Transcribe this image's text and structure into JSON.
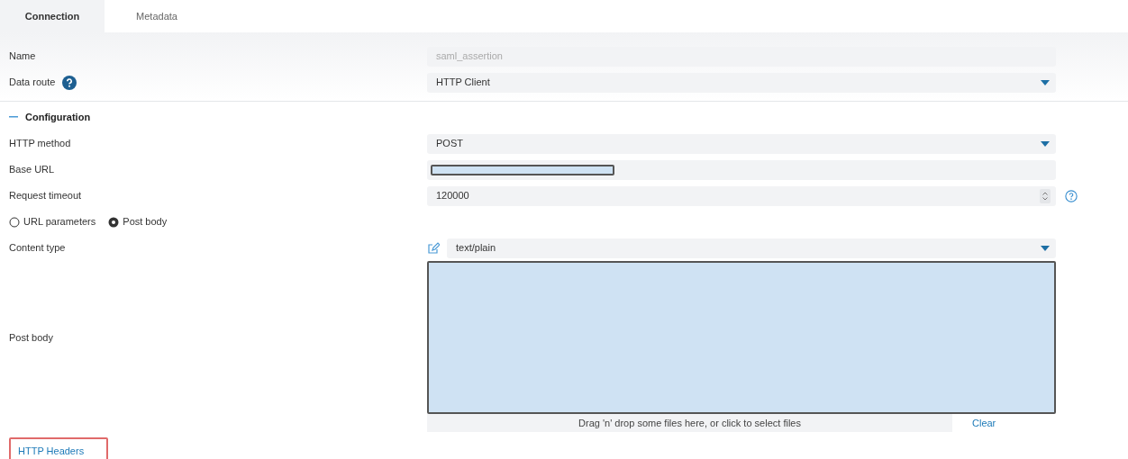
{
  "tabs": [
    {
      "label": "Connection",
      "selected": true
    },
    {
      "label": "Metadata",
      "selected": false
    }
  ],
  "top_fields": [
    {
      "kind": "text",
      "label": "Name",
      "value": "saml_assertion",
      "disabled": true
    },
    {
      "kind": "select",
      "label": "Data route",
      "value": "HTTP Client",
      "help": true
    }
  ],
  "configuration": {
    "title": "Configuration",
    "expanded": true,
    "fields": [
      {
        "kind": "select",
        "label": "HTTP method",
        "value": "POST"
      },
      {
        "kind": "redacted",
        "label": "Base URL"
      },
      {
        "kind": "number",
        "label": "Request timeout",
        "value": "120000",
        "help": true
      },
      {
        "kind": "radios",
        "options": [
          {
            "label": "URL parameters",
            "selected": false
          },
          {
            "label": "Post body",
            "selected": true
          }
        ]
      },
      {
        "kind": "select",
        "label": "Content type",
        "value": "text/plain",
        "editable": true
      },
      {
        "kind": "redacted_area",
        "label": "Post body"
      },
      {
        "kind": "dropzone",
        "text": "Drag 'n' drop some files here, or click to select files",
        "action": "Clear"
      }
    ]
  },
  "http_headers": {
    "label": "HTTP Headers",
    "highlighted": true
  }
}
